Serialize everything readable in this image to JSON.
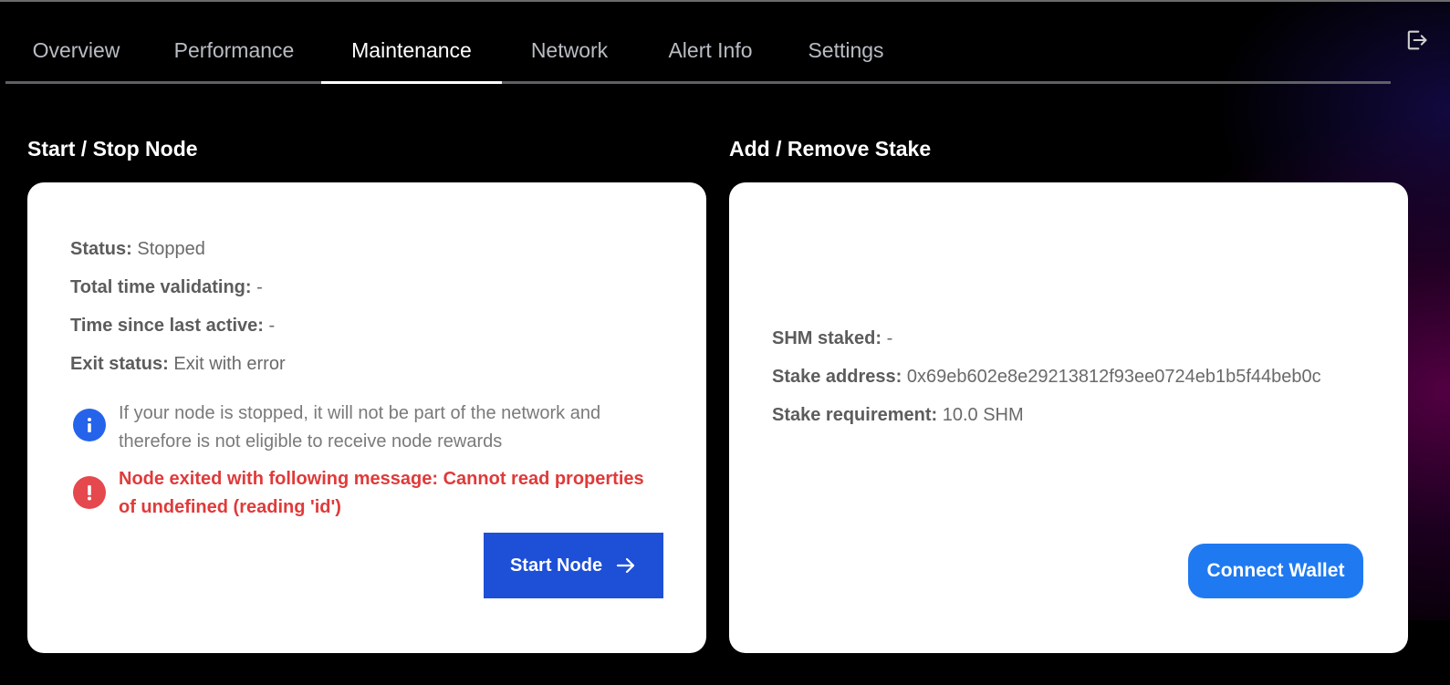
{
  "tabs": [
    {
      "label": "Overview"
    },
    {
      "label": "Performance"
    },
    {
      "label": "Maintenance"
    },
    {
      "label": "Network"
    },
    {
      "label": "Alert Info"
    },
    {
      "label": "Settings"
    }
  ],
  "active_tab": "Maintenance",
  "node": {
    "title": "Start / Stop Node",
    "status_label": "Status:",
    "status_value": "Stopped",
    "total_time_label": "Total time validating:",
    "total_time_value": "-",
    "since_active_label": "Time since last active:",
    "since_active_value": "-",
    "exit_label": "Exit status:",
    "exit_value": "Exit with error",
    "info_message": "If your node is stopped, it will not be part of the network and therefore is not eligible to receive node rewards",
    "error_message": "Node exited with following message: Cannot read properties of undefined (reading 'id')",
    "start_button": "Start Node"
  },
  "stake": {
    "title": "Add / Remove Stake",
    "staked_label": "SHM staked:",
    "staked_value": "-",
    "address_label": "Stake address:",
    "address_value": "0x69eb602e8e29213812f93ee0724eb1b5f44beb0c",
    "requirement_label": "Stake requirement:",
    "requirement_value": "10.0 SHM",
    "connect_button": "Connect Wallet"
  },
  "colors": {
    "primary_button": "#1d4fd7",
    "wallet_button": "#1f7af1",
    "error": "#e03a3a",
    "info_icon": "#2563eb"
  },
  "icons": {
    "logout": "logout-icon",
    "info": "info-icon",
    "error": "exclamation-icon",
    "arrow": "arrow-right-icon"
  }
}
